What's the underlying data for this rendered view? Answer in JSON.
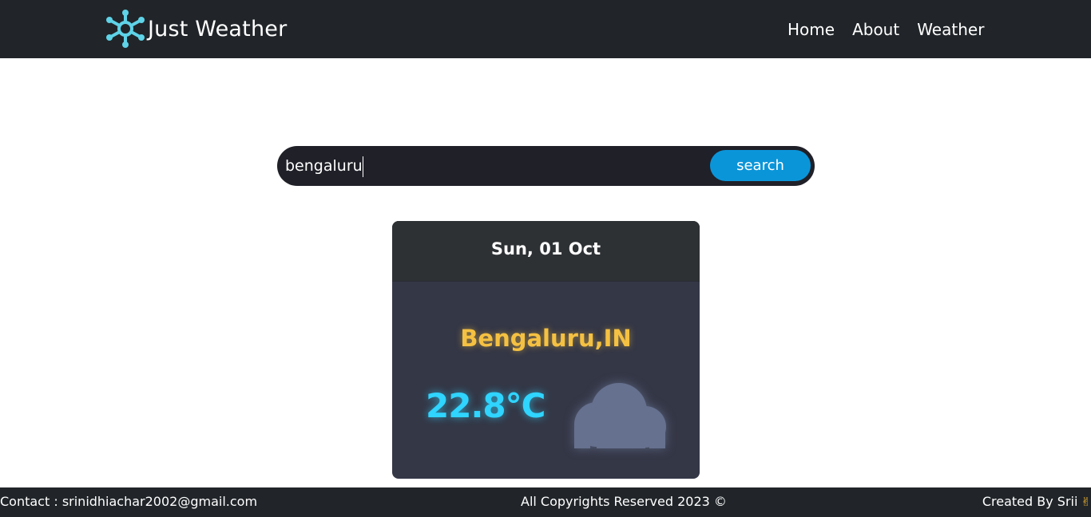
{
  "navbar": {
    "brand": "Just Weather",
    "links": [
      "Home",
      "About",
      "Weather"
    ]
  },
  "search": {
    "value": "bengaluru",
    "placeholder": "",
    "button_label": "search"
  },
  "weather_card": {
    "date": "Sun, 01 Oct",
    "city": "Bengaluru,IN",
    "temperature": "22.8°C",
    "icon": "cloud-icon"
  },
  "footer": {
    "contact": "Contact : srinidhiachar2002@gmail.com",
    "copyright": "All Copyrights Reserved 2023 ©",
    "credit": "Created By Srii"
  },
  "colors": {
    "navbar": "#212529",
    "brand_icon": "#5fd3e8",
    "search_button": "#0b95d9",
    "card_body": "#343746",
    "card_header": "#2e3134",
    "city": "#f5c142",
    "temperature": "#2fd4ff",
    "cloud": "#66718f"
  }
}
